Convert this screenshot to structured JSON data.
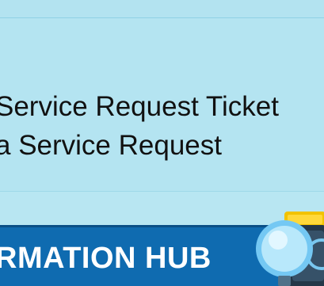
{
  "slide": {
    "line_1": "Service Request Ticket",
    "line_2": "a Service Request"
  },
  "banner": {
    "title": "RMATION HUB"
  },
  "icons": {
    "illustration": "magnifier-folder-icon"
  },
  "colors": {
    "background": "#b9e6f2",
    "banner": "#0f6bb0",
    "banner_text": "#ffffff",
    "text": "#111111",
    "folder": "#f2c200"
  }
}
